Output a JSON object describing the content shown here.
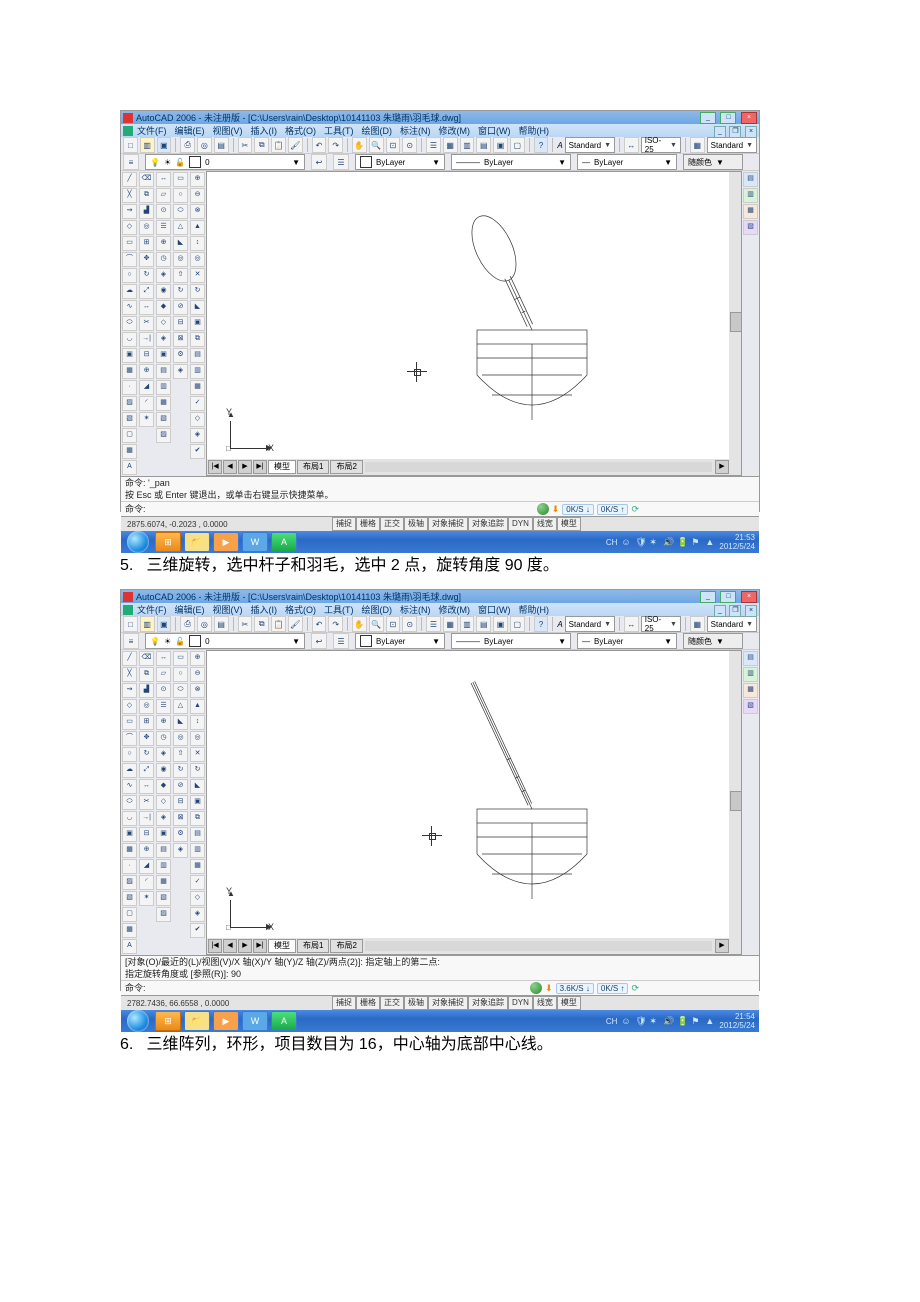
{
  "app": {
    "title": "AutoCAD 2006 - 未注册版 - [C:\\Users\\rain\\Desktop\\10141103 朱璐雨\\羽毛球.dwg]"
  },
  "menu": {
    "file": "文件(F)",
    "edit": "编辑(E)",
    "view": "视图(V)",
    "insert": "插入(I)",
    "format": "格式(O)",
    "tools": "工具(T)",
    "draw": "绘图(D)",
    "dimension": "标注(N)",
    "modify": "修改(M)",
    "window": "窗口(W)",
    "help": "帮助(H)"
  },
  "toolbar1": {
    "text_style": "Standard",
    "dim_style": "ISO-25",
    "table_style": "Standard"
  },
  "layerbar": {
    "layer_drop": "0",
    "color": "ByLayer",
    "linetype": "ByLayer",
    "lineweight": "ByLayer",
    "plotstyle": "随颜色"
  },
  "axes": {
    "x": "X",
    "y": "Y"
  },
  "tabs": {
    "model": "模型",
    "layout1": "布局1",
    "layout2": "布局2"
  },
  "screenshot1": {
    "cmd1": "命令:   '_pan",
    "cmd2": "按 Esc 或 Enter 键退出，或单击右键显示快捷菜单。",
    "cmd_prompt": "命令:",
    "download": "0K/S ↓",
    "upload": "0K/S ↑",
    "coords": "2875.6074, -0.2023 , 0.0000",
    "time": "21:53",
    "date": "2012/5/24"
  },
  "screenshot2": {
    "cmd1": "  [对象(O)/最近的(L)/视图(V)/X 轴(X)/Y 轴(Y)/Z 轴(Z)/两点(2)]: 指定轴上的第二点:",
    "cmd2": "指定旋转角度或 [参照(R)]: 90",
    "cmd_prompt": "命令:",
    "download": "3.6K/S ↓",
    "upload": "0K/S ↑",
    "coords": "2782.7436, 66.6558 , 0.0000",
    "time": "21:54",
    "date": "2012/5/24"
  },
  "status_modes": [
    "捕捉",
    "栅格",
    "正交",
    "极轴",
    "对象捕捉",
    "对象追踪",
    "DYN",
    "线宽",
    "模型"
  ],
  "tray_label": "CH",
  "step5": {
    "num": "5.",
    "text": "三维旋转，选中杆子和羽毛，选中 2 点，旋转角度 90 度。"
  },
  "step6": {
    "num": "6.",
    "text": "三维阵列，环形，项目数目为 16，中心轴为底部中心线。"
  }
}
